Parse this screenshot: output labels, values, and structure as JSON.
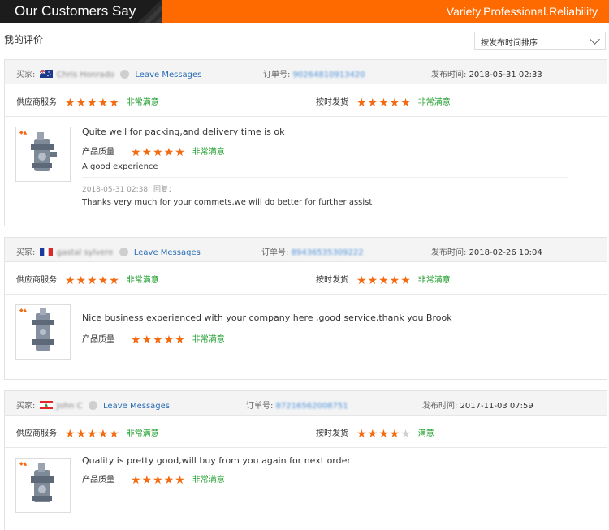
{
  "banner": {
    "title": "Our Customers Say",
    "slogan": "Variety.Professional.Reliability"
  },
  "page": {
    "my_reviews": "我的评价",
    "sort_label": "按发布时间排序"
  },
  "labels": {
    "buyer": "买家:",
    "leave_messages": "Leave Messages",
    "order_no": "订单号:",
    "publish_time": "发布时间:",
    "supplier_service": "供应商服务",
    "on_time_delivery": "按时发货",
    "product_quality": "产品质量",
    "reply": "回复："
  },
  "colors": {
    "accent": "#ff6a00",
    "star": "#f36a10",
    "verdict": "#1c9c2a",
    "link": "#2a6db5"
  },
  "reviews": [
    {
      "buyer_name": "Chris Honrado",
      "flag": "australia-flag",
      "order_no": "90264810913420",
      "publish_time": "2018-05-31 02:33",
      "supplier_service": {
        "stars": 5,
        "verdict": "非常满意"
      },
      "on_time_delivery": {
        "stars": 5,
        "verdict": "非常满意"
      },
      "text": "Quite well for packing,and delivery time is ok",
      "product_quality": {
        "stars": 5,
        "verdict": "非常满意"
      },
      "extra": "A good experience",
      "reply_time": "2018-05-31 02:38",
      "reply_text": "Thanks very much for your commets,we will do better for further assist"
    },
    {
      "buyer_name": "gastal sylvere",
      "flag": "france-flag",
      "order_no": "89436535309222",
      "publish_time": "2018-02-26 10:04",
      "supplier_service": {
        "stars": 5,
        "verdict": "非常满意"
      },
      "on_time_delivery": {
        "stars": 5,
        "verdict": "非常满意"
      },
      "text": "Nice business experienced with your company here ,good service,thank you Brook",
      "product_quality": {
        "stars": 5,
        "verdict": "非常满意"
      }
    },
    {
      "buyer_name": "John C",
      "flag": "lebanon-flag",
      "order_no": "87216562008751",
      "publish_time": "2017-11-03 07:59",
      "supplier_service": {
        "stars": 5,
        "verdict": "非常满意"
      },
      "on_time_delivery": {
        "stars": 4,
        "verdict": "满意"
      },
      "text": "Quality is pretty good,will buy from you again for next order",
      "product_quality": {
        "stars": 5,
        "verdict": "非常满意"
      }
    }
  ]
}
